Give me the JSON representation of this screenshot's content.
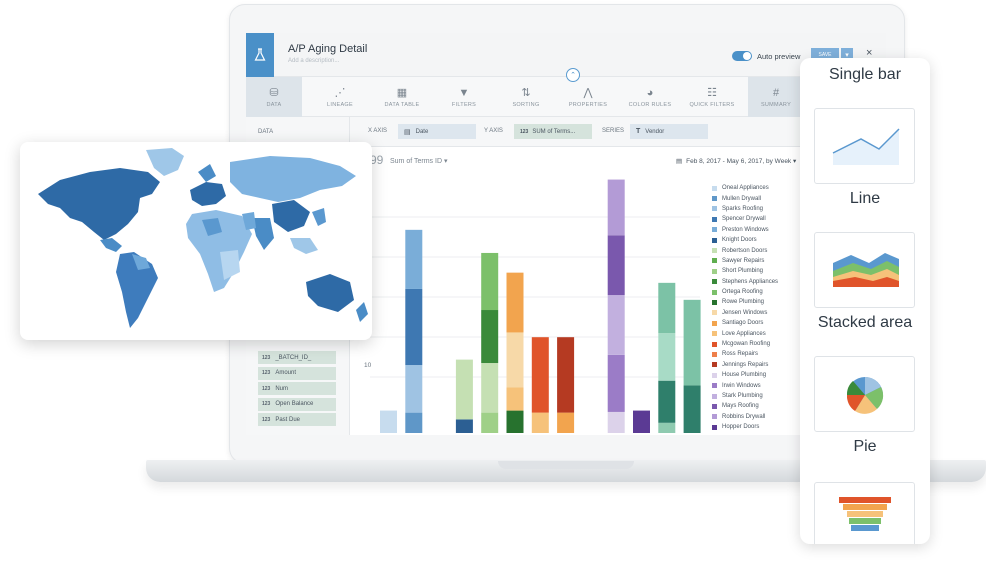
{
  "report": {
    "title": "A/P Aging Detail",
    "description_placeholder": "Add a description...",
    "auto_preview_label": "Auto preview",
    "save_label": "SAVE",
    "close_glyph": "×",
    "caret_glyph": "⌃",
    "auto_preview_on": true
  },
  "toolbar": [
    {
      "label": "DATA",
      "icon": "database-icon",
      "glyph": "⛁",
      "active": true
    },
    {
      "label": "LINEAGE",
      "icon": "lineage-icon",
      "glyph": "⋰"
    },
    {
      "label": "DATA TABLE",
      "icon": "table-icon",
      "glyph": "▦"
    },
    {
      "label": "FILTERS",
      "icon": "filter-icon",
      "glyph": "▼"
    },
    {
      "label": "SORTING",
      "icon": "sort-icon",
      "glyph": "⇅"
    },
    {
      "label": "PROPERTIES",
      "icon": "properties-icon",
      "glyph": "⋀"
    },
    {
      "label": "COLOR RULES",
      "icon": "palette-icon",
      "glyph": "◕"
    },
    {
      "label": "QUICK FILTERS",
      "icon": "quick-filter-icon",
      "glyph": "☷"
    },
    {
      "label": "SUMMARY",
      "icon": "hash-icon",
      "glyph": "#",
      "active": true
    }
  ],
  "sidebar": {
    "label": "DATA",
    "fields": [
      {
        "type": "123",
        "name": "_BATCH_ID_"
      },
      {
        "type": "123",
        "name": "Amount"
      },
      {
        "type": "123",
        "name": "Num"
      },
      {
        "type": "123",
        "name": "Open Balance"
      },
      {
        "type": "123",
        "name": "Past Due"
      }
    ]
  },
  "axes": {
    "x_label": "X AXIS",
    "x_value": "Date",
    "y_label": "Y AXIS",
    "y_type": "123",
    "y_value": "SUM of Terms...",
    "series_label": "SERIES",
    "series_type": "T",
    "series_value": "Vendor"
  },
  "chart_header": {
    "metric_value": "99",
    "metric_label": "Sum of Terms ID",
    "date_range": "Feb 8, 2017 - May 6, 2017, by Week"
  },
  "chart_data": {
    "type": "bar",
    "stacked": true,
    "ytick_label": "10",
    "ytick_value": 10,
    "ymax_visible": 36.5,
    "legend_placement": "right",
    "vendors": [
      {
        "name": "Oneal Appliances",
        "color": "#c7dcee"
      },
      {
        "name": "Mullen Drywall",
        "color": "#5f97c8"
      },
      {
        "name": "Sparks Roofing",
        "color": "#9fc3e3"
      },
      {
        "name": "Spencer Drywall",
        "color": "#3e78b2"
      },
      {
        "name": "Preston Windows",
        "color": "#7aadd8"
      },
      {
        "name": "Knight Doors",
        "color": "#2c5f93"
      },
      {
        "name": "Robertson Doors",
        "color": "#c5e0b3"
      },
      {
        "name": "Sawyer Repairs",
        "color": "#5fae4f"
      },
      {
        "name": "Short Plumbing",
        "color": "#9fd088"
      },
      {
        "name": "Stephens Appliances",
        "color": "#3a8a3a"
      },
      {
        "name": "Ortega Roofing",
        "color": "#7cc06a"
      },
      {
        "name": "Rowe Plumbing",
        "color": "#27722e"
      },
      {
        "name": "Jensen Windows",
        "color": "#f7d9a8"
      },
      {
        "name": "Santiago Doors",
        "color": "#f2a44e"
      },
      {
        "name": "Love Appliances",
        "color": "#f6c27a"
      },
      {
        "name": "Mcgowan Roofing",
        "color": "#e0542a"
      },
      {
        "name": "Ross Repairs",
        "color": "#ee7f4a"
      },
      {
        "name": "Jennings Repairs",
        "color": "#b53a22"
      },
      {
        "name": "House Plumbing",
        "color": "#dcd2ea"
      },
      {
        "name": "Irwin Windows",
        "color": "#9b7cc7"
      },
      {
        "name": "Stark Plumbing",
        "color": "#c2b0df"
      },
      {
        "name": "Mays Roofing",
        "color": "#7a58ad"
      },
      {
        "name": "Robbins Drywall",
        "color": "#b39bd6"
      },
      {
        "name": "Hopper Doors",
        "color": "#5b3a94"
      }
    ],
    "bars": [
      [
        {
          "v": 3.3,
          "c": "#c7dcee"
        }
      ],
      [
        {
          "v": 3.0,
          "c": "#5f97c8"
        },
        {
          "v": 7.0,
          "c": "#9fc3e3"
        },
        {
          "v": 11.2,
          "c": "#3e78b2"
        },
        {
          "v": 8.7,
          "c": "#7aadd8"
        }
      ],
      [],
      [
        {
          "v": 2.0,
          "c": "#2c5f93"
        },
        {
          "v": 8.8,
          "c": "#c5e0b3"
        }
      ],
      [
        {
          "v": 3.0,
          "c": "#9fd088"
        },
        {
          "v": 7.3,
          "c": "#c5e0b3"
        },
        {
          "v": 7.8,
          "c": "#3a8a3a"
        },
        {
          "v": 8.4,
          "c": "#7cc06a"
        }
      ],
      [
        {
          "v": 3.3,
          "c": "#27722e"
        },
        {
          "v": 3.4,
          "c": "#f6c27a"
        },
        {
          "v": 8.1,
          "c": "#f7d9a8"
        },
        {
          "v": 8.8,
          "c": "#f2a44e"
        }
      ],
      [
        {
          "v": 3.0,
          "c": "#f6c27a"
        },
        {
          "v": 11.1,
          "c": "#e0542a"
        }
      ],
      [
        {
          "v": 3.0,
          "c": "#f2a44e"
        },
        {
          "v": 11.1,
          "c": "#b53a22"
        }
      ],
      [],
      [
        {
          "v": 3.1,
          "c": "#dcd2ea"
        },
        {
          "v": 8.4,
          "c": "#9b7cc7"
        },
        {
          "v": 8.8,
          "c": "#c2b0df"
        },
        {
          "v": 8.8,
          "c": "#7a58ad"
        },
        {
          "v": 8.2,
          "c": "#b39bd6"
        }
      ],
      [
        {
          "v": 3.3,
          "c": "#5b3a94"
        }
      ],
      [
        {
          "v": 1.5,
          "c": "#8fcab0"
        },
        {
          "v": 6.2,
          "c": "#2f7f6b"
        },
        {
          "v": 7.0,
          "c": "#a8dbc6"
        },
        {
          "v": 7.4,
          "c": "#7cc2a6"
        }
      ],
      [
        {
          "v": 7.0,
          "c": "#2f7f6b"
        },
        {
          "v": 12.6,
          "c": "#7cc2a6"
        }
      ]
    ]
  },
  "map": {
    "alt": "world map"
  },
  "chart_types": [
    {
      "label": "Single bar",
      "icon": "single-bar-icon"
    },
    {
      "label": "Line",
      "icon": "line-chart-icon"
    },
    {
      "label": "Stacked area",
      "icon": "stacked-area-icon"
    },
    {
      "label": "Pie",
      "icon": "pie-chart-icon"
    },
    {
      "label": "",
      "icon": "funnel-chart-icon"
    }
  ]
}
